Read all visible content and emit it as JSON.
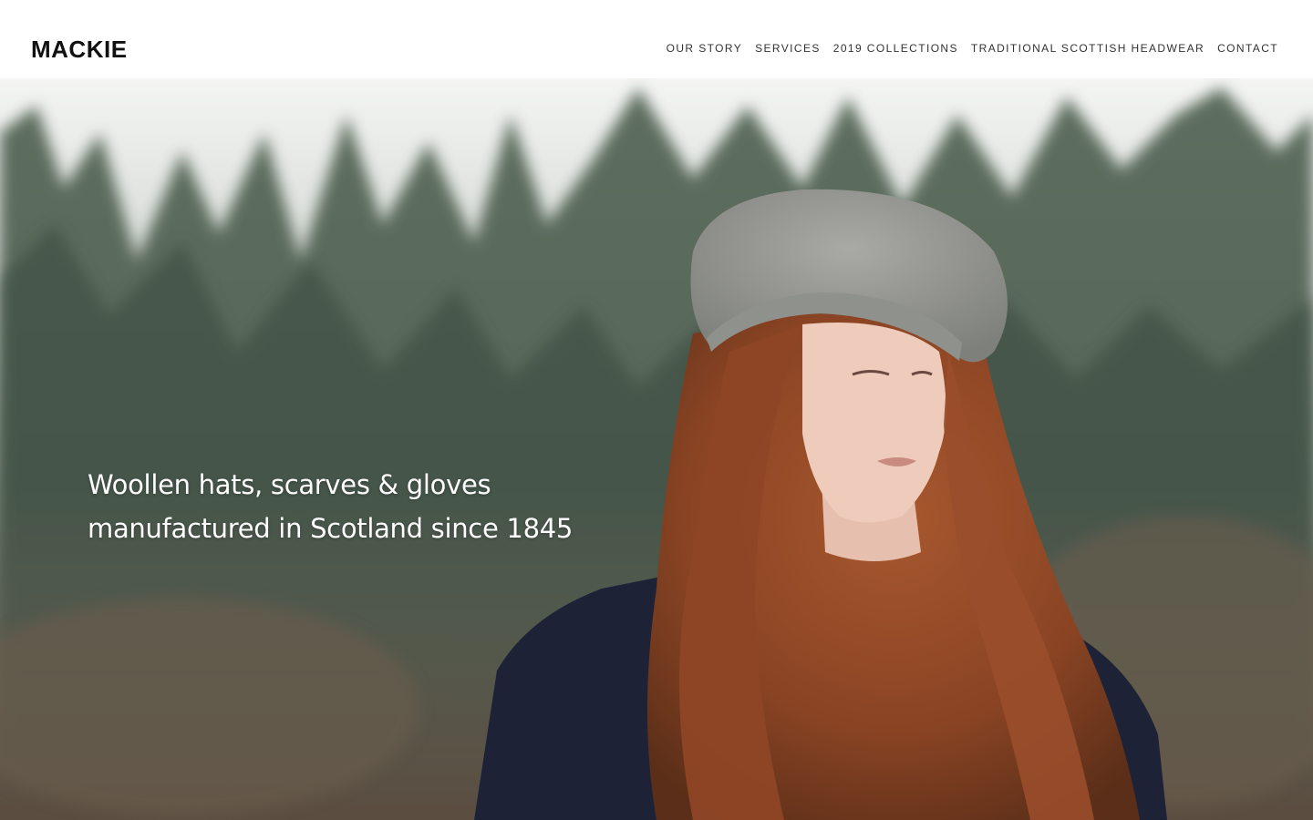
{
  "brand": {
    "logo_text": "MACKIE"
  },
  "nav": {
    "items": [
      {
        "label": "OUR STORY"
      },
      {
        "label": "SERVICES"
      },
      {
        "label": "2019 COLLECTIONS"
      },
      {
        "label": "TRADITIONAL SCOTTISH HEADWEAR"
      },
      {
        "label": "CONTACT"
      }
    ]
  },
  "hero": {
    "tagline_line1": "Woollen hats, scarves & gloves",
    "tagline_line2": "manufactured in Scotland since 1845",
    "image_subject": "photo"
  },
  "colors": {
    "text_dark": "#111111",
    "nav_text": "#333333",
    "tagline_text": "#ffffff",
    "header_bg": "#ffffff"
  }
}
